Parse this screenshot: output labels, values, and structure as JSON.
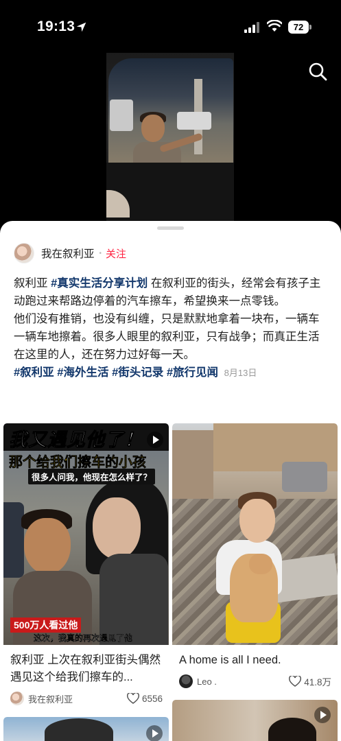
{
  "status_bar": {
    "time": "19:13",
    "battery": "72"
  },
  "post": {
    "author": "我在叙利亚",
    "follow_label": "关注",
    "text_prefix": "叙利亚 ",
    "inline_tag": "#真实生活分享计划",
    "text_after_tag": " 在叙利亚的街头，经常会有孩子主动跑过来帮路边停着的汽车擦车，希望换来一点零钱。",
    "paragraph2": "他们没有推销，也没有纠缠，只是默默地拿着一块布，一辆车一辆车地擦着。很多人眼里的叙利亚，只有战争；而真正生活在这里的人，还在努力过好每一天。",
    "tags": [
      "#叙利亚",
      "#海外生活",
      "#街头记录",
      "#旅行见闻"
    ],
    "date": "8月13日"
  },
  "feed": {
    "cards": [
      {
        "overlay_title_line1": "我又遇见他了！",
        "overlay_title_line2": "那个给我们擦车的小孩",
        "overlay_subtitle": "很多人问我，他现在怎么样了？",
        "overlay_count": "500万人看过他",
        "overlay_caption": "这次，我真的再次遇见了他",
        "title": "叙利亚 上次在叙利亚街头偶然遇见这个给我们擦车的...",
        "author": "我在叙利亚",
        "likes": "6556"
      },
      {
        "title": "A home is all I need.",
        "author": "Leo .",
        "likes": "41.8万"
      }
    ]
  },
  "colors": {
    "accent": "#ff2442",
    "tag": "#13386c"
  },
  "icons": [
    "location-arrow-icon",
    "signal-icon",
    "wifi-icon",
    "battery-icon",
    "search-icon",
    "heart-icon",
    "play-icon"
  ]
}
